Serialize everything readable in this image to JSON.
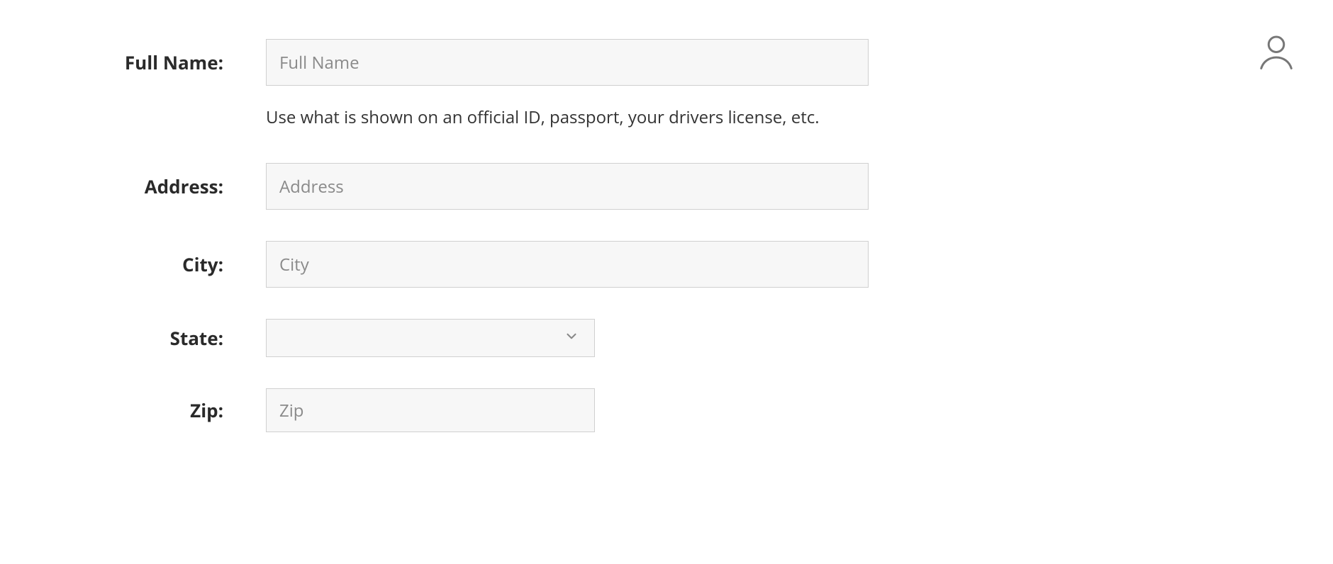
{
  "form": {
    "fullName": {
      "label": "Full Name:",
      "placeholder": "Full Name",
      "value": "",
      "helper": "Use what is shown on an official ID, passport, your drivers license, etc."
    },
    "address": {
      "label": "Address:",
      "placeholder": "Address",
      "value": ""
    },
    "city": {
      "label": "City:",
      "placeholder": "City",
      "value": ""
    },
    "state": {
      "label": "State:",
      "selected": ""
    },
    "zip": {
      "label": "Zip:",
      "placeholder": "Zip",
      "value": ""
    }
  }
}
